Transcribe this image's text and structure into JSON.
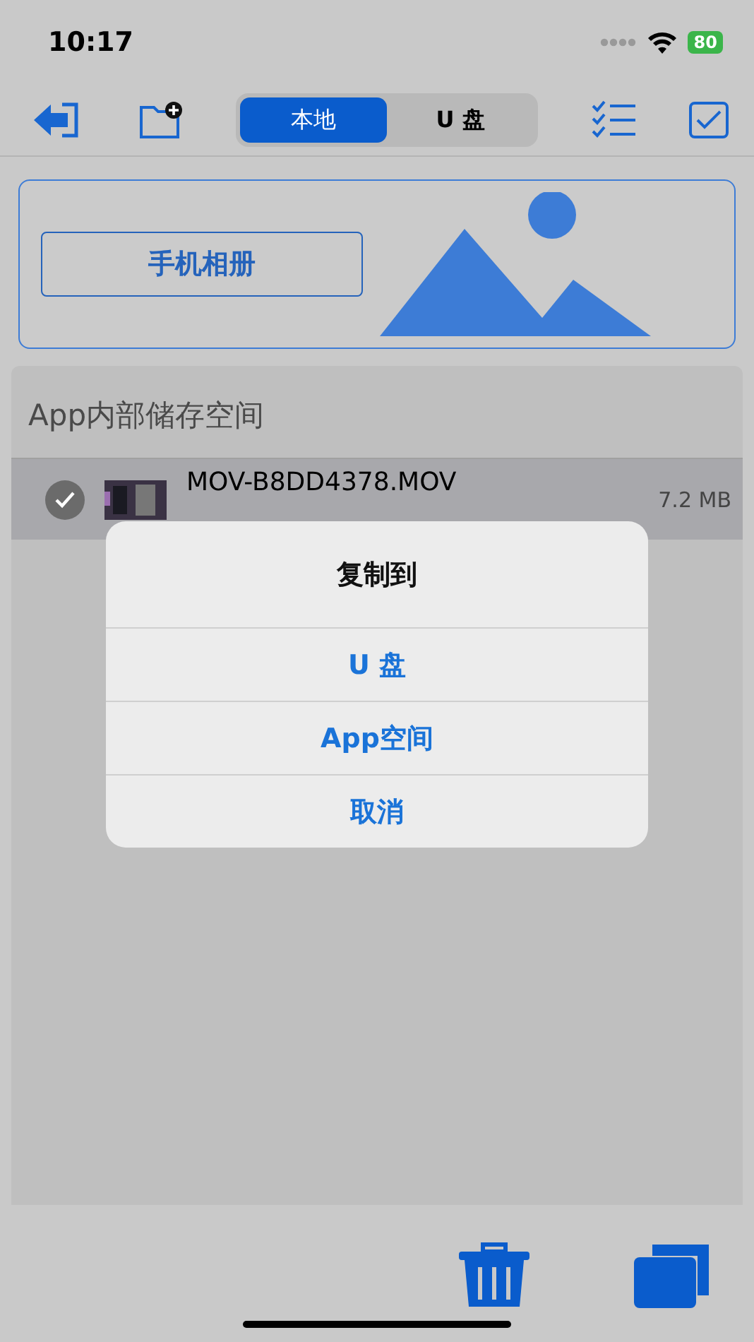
{
  "status_bar": {
    "time": "10:17",
    "battery": "80"
  },
  "toolbar": {
    "segments": [
      {
        "label": "本地",
        "selected": true
      },
      {
        "label": "U 盘",
        "selected": false
      }
    ]
  },
  "album": {
    "button": "手机相册"
  },
  "section": {
    "title": "App内部储存空间",
    "files": [
      {
        "name": "MOV-B8DD4378.MOV",
        "size": "7.2 MB",
        "checked": true
      }
    ]
  },
  "dialog": {
    "title": "复制到",
    "options": [
      "U 盘",
      "App空间",
      "取消"
    ]
  }
}
